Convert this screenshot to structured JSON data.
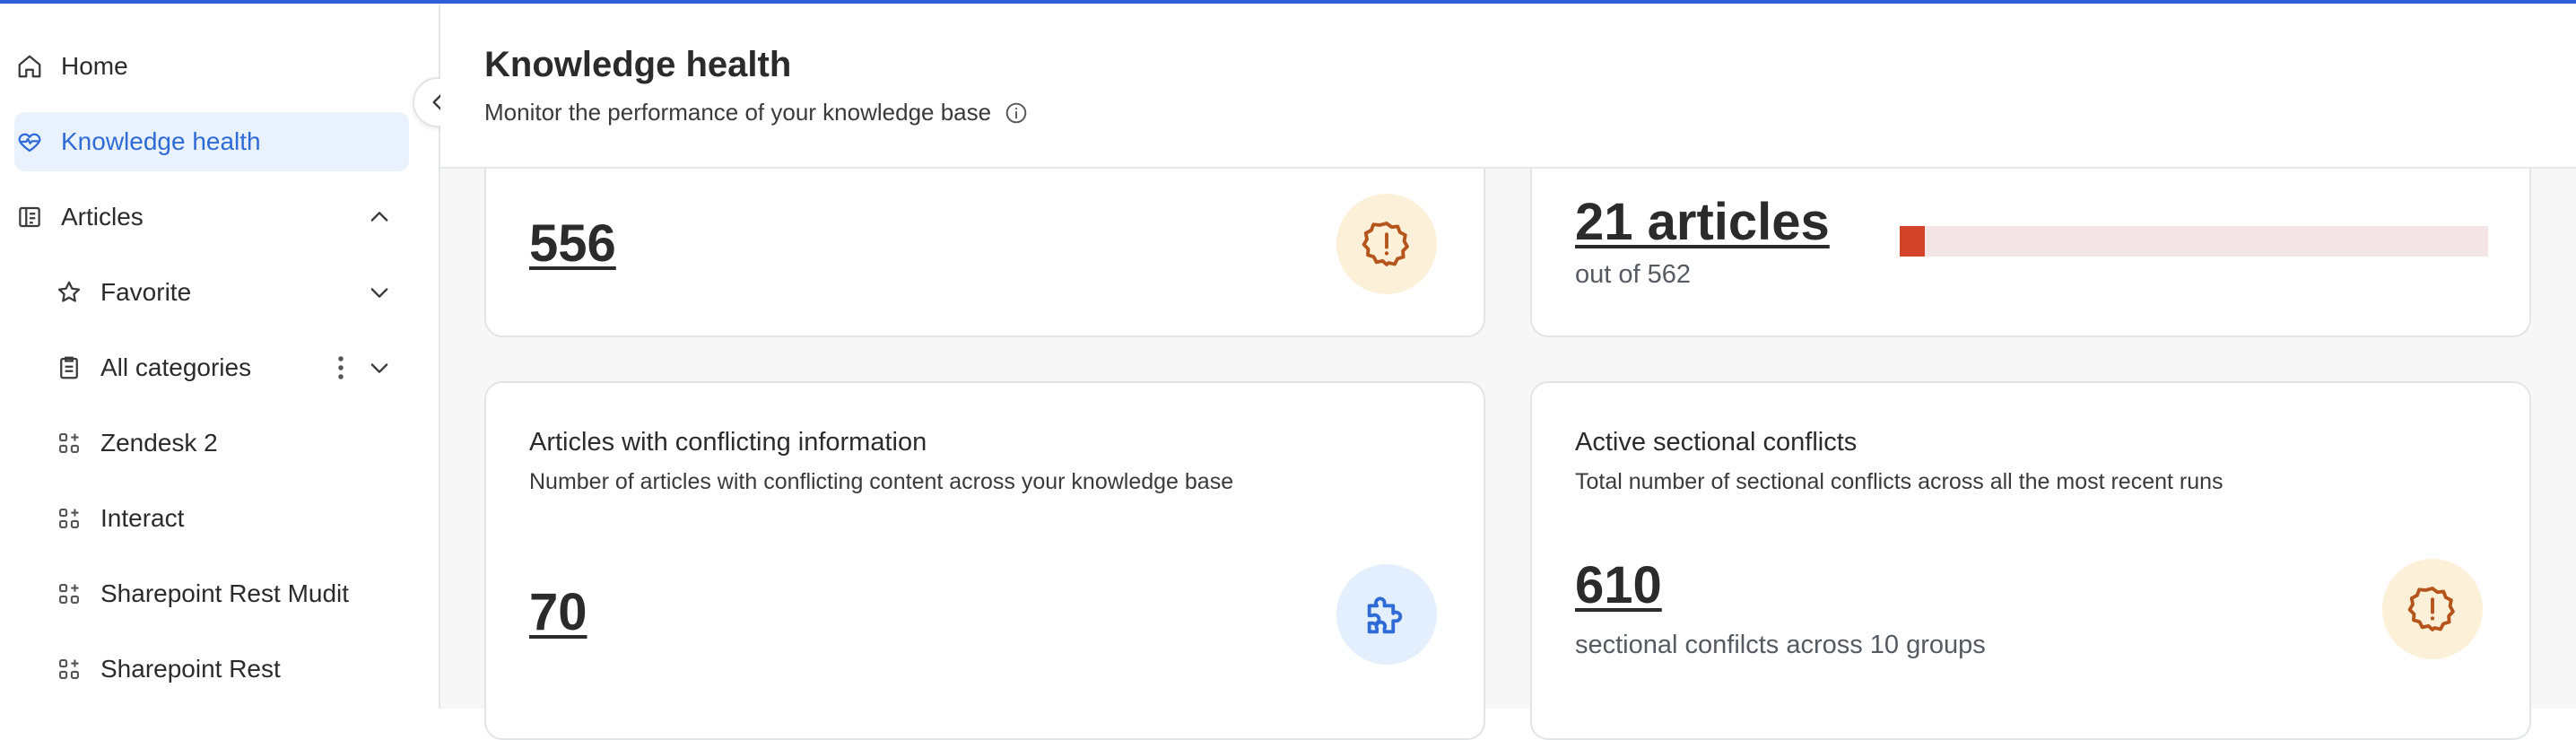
{
  "sidebar": {
    "items": [
      {
        "label": "Home",
        "icon": "home-icon"
      },
      {
        "label": "Knowledge health",
        "icon": "heart-pulse-icon",
        "active": true
      },
      {
        "label": "Articles",
        "icon": "articles-icon"
      },
      {
        "label": "Favorite",
        "icon": "star-icon"
      },
      {
        "label": "All categories",
        "icon": "clipboard-icon"
      },
      {
        "label": "Zendesk 2",
        "icon": "integration-icon"
      },
      {
        "label": "Interact",
        "icon": "integration-icon"
      },
      {
        "label": "Sharepoint Rest Mudit",
        "icon": "integration-icon"
      },
      {
        "label": "Sharepoint Rest",
        "icon": "integration-icon"
      }
    ]
  },
  "header": {
    "title": "Knowledge health",
    "subtitle": "Monitor the performance of your knowledge base"
  },
  "cards": {
    "top_left": {
      "value": "556"
    },
    "top_right": {
      "value": "21 articles",
      "sub": "out of 562",
      "progress": 21,
      "progress_total": 562
    },
    "conflicting": {
      "title": "Articles with conflicting information",
      "desc": "Number of articles with conflicting content across your knowledge base",
      "value": "70"
    },
    "sectional": {
      "title": "Active sectional conflicts",
      "desc": "Total number of sectional conflicts across all the most recent runs",
      "value": "610",
      "sub": "sectional confilcts across 10 groups"
    }
  },
  "colors": {
    "accent": "#2e6bd6",
    "warning": "#b5541b",
    "danger": "#d2452a",
    "info": "#2e6bd6"
  }
}
